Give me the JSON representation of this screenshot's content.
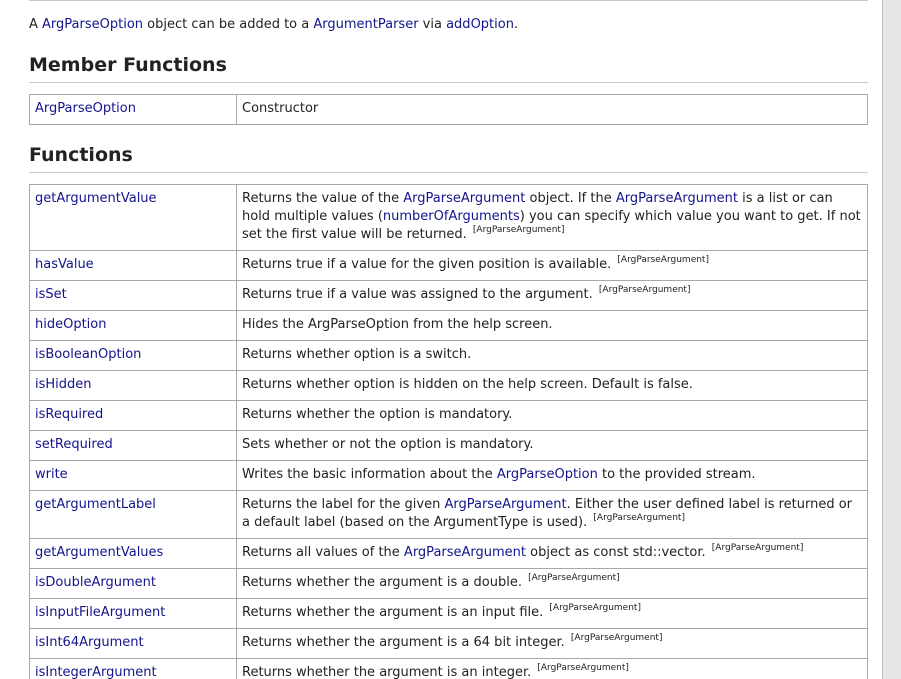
{
  "intro": {
    "prefix": "A ",
    "link1": "ArgParseOption",
    "mid1": " object can be added to a ",
    "link2": "ArgumentParser",
    "mid2": " via ",
    "link3": "addOption",
    "suffix": "."
  },
  "member_functions": {
    "heading": "Member Functions",
    "rows": [
      {
        "name": "ArgParseOption",
        "description": "Constructor"
      }
    ]
  },
  "functions": {
    "heading": "Functions",
    "ref_label": "[ArgParseArgument]",
    "rows": [
      {
        "name": "getArgumentValue",
        "parts": [
          "Returns the value of the ",
          "ArgParseArgument",
          " object. If the ",
          "ArgParseArgument",
          " is a list or can hold multiple values (",
          "numberOfArguments",
          ") you can specify which value you want to get. If not set the first value will be returned."
        ],
        "ref": "[ArgParseArgument]"
      },
      {
        "name": "hasValue",
        "description": "Returns true if a value for the given position is available.",
        "ref": "[ArgParseArgument]"
      },
      {
        "name": "isSet",
        "description": "Returns true if a value was assigned to the argument.",
        "ref": "[ArgParseArgument]"
      },
      {
        "name": "hideOption",
        "description": "Hides the ArgParseOption from the help screen."
      },
      {
        "name": "isBooleanOption",
        "description": "Returns whether option is a switch."
      },
      {
        "name": "isHidden",
        "description": "Returns whether option is hidden on the help screen. Default is false."
      },
      {
        "name": "isRequired",
        "description": "Returns whether the option is mandatory."
      },
      {
        "name": "setRequired",
        "description": "Sets whether or not the option is mandatory."
      },
      {
        "name": "write",
        "parts": [
          "Writes the basic information about the ",
          "ArgParseOption",
          " to the provided stream."
        ]
      },
      {
        "name": "getArgumentLabel",
        "parts": [
          "Returns the label for the given ",
          "ArgParseArgument",
          ". Either the user defined label is returned or a default label (based on the ArgumentType is used)."
        ],
        "ref": "[ArgParseArgument]"
      },
      {
        "name": "getArgumentValues",
        "parts": [
          "Returns all values of the ",
          "ArgParseArgument",
          " object as const std::vector."
        ],
        "ref": "[ArgParseArgument]"
      },
      {
        "name": "isDoubleArgument",
        "description": "Returns whether the argument is a double.",
        "ref": "[ArgParseArgument]"
      },
      {
        "name": "isInputFileArgument",
        "description": "Returns whether the argument is an input file.",
        "ref": "[ArgParseArgument]"
      },
      {
        "name": "isInt64Argument",
        "description": "Returns whether the argument is a 64 bit integer.",
        "ref": "[ArgParseArgument]"
      },
      {
        "name": "isIntegerArgument",
        "description": "Returns whether the argument is an integer.",
        "ref": "[ArgParseArgument]"
      }
    ]
  }
}
